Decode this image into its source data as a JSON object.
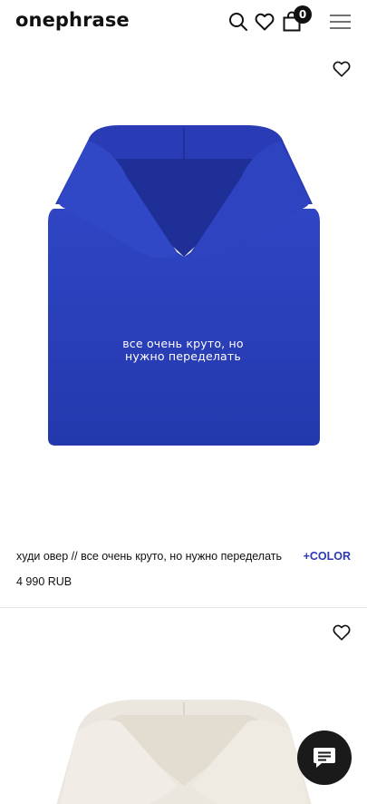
{
  "header": {
    "logo": "onephrase",
    "cart_count": "0",
    "icons": [
      "search-icon",
      "heart-icon",
      "bag-icon",
      "menu-icon"
    ]
  },
  "products": [
    {
      "name": "худи овер // все очень круто, но нужно переделать",
      "color_link": "+COLOR",
      "price": "4 990 RUB",
      "print_line1": "все очень круто, но",
      "print_line2": "нужно переделать",
      "garment_color": "#2a3fb8"
    },
    {
      "garment_color": "#efebe3"
    }
  ],
  "chat": {
    "icon": "chat-icon"
  },
  "colors": {
    "accent": "#2d3ab4",
    "text": "#111111",
    "divider": "#e6e6e6"
  }
}
